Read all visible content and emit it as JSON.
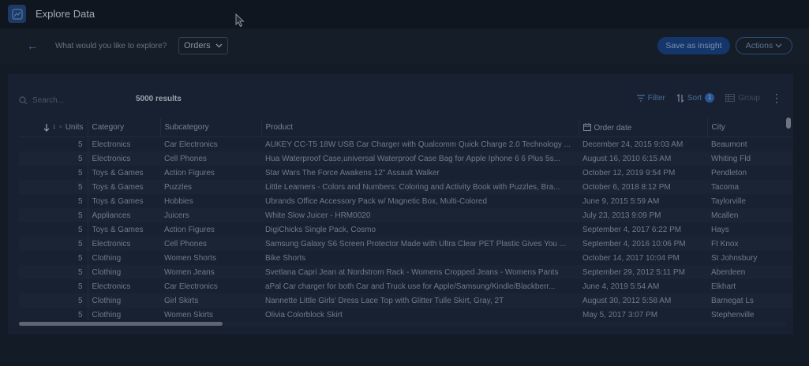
{
  "app": {
    "title": "Explore Data"
  },
  "toolbar": {
    "explore_label": "What would you like to explore?",
    "dataset_value": "Orders",
    "save_label": "Save as insight",
    "actions_label": "Actions"
  },
  "panel": {
    "search_placeholder": "Search...",
    "results_count": "5000 results",
    "filter_label": "Filter",
    "sort_label": "Sort",
    "sort_count": "1",
    "group_label": "Group"
  },
  "table": {
    "headers": {
      "sort_small": "1",
      "units": "Units",
      "category": "Category",
      "subcategory": "Subcategory",
      "product": "Product",
      "order_date": "Order date",
      "city": "City"
    },
    "rows": [
      {
        "units": "5",
        "category": "Electronics",
        "subcategory": "Car Electronics",
        "product": "AUKEY CC-T5 18W USB Car Charger with Qualcomm Quick Charge 2.0 Technology ...",
        "order_date": "December 24, 2015 9:03 AM",
        "city": "Beaumont"
      },
      {
        "units": "5",
        "category": "Electronics",
        "subcategory": "Cell Phones",
        "product": "Hua Waterproof Case,universal Waterproof Case Bag for Apple Iphone 6 6 Plus 5s...",
        "order_date": "August 16, 2010 6:15 AM",
        "city": "Whiting Fld"
      },
      {
        "units": "5",
        "category": "Toys & Games",
        "subcategory": "Action Figures",
        "product": "Star Wars The Force Awakens 12\" Assault Walker",
        "order_date": "October 12, 2019 9:54 PM",
        "city": "Pendleton"
      },
      {
        "units": "5",
        "category": "Toys & Games",
        "subcategory": "Puzzles",
        "product": "Little Learners - Colors and Numbers: Coloring and Activity Book with Puzzles, Bra...",
        "order_date": "October 6, 2018 8:12 PM",
        "city": "Tacoma"
      },
      {
        "units": "5",
        "category": "Toys & Games",
        "subcategory": "Hobbies",
        "product": "Ubrands Office Accessory Pack w/ Magnetic Box, Multi-Colored",
        "order_date": "June 9, 2015 5:59 AM",
        "city": "Taylorville"
      },
      {
        "units": "5",
        "category": "Appliances",
        "subcategory": "Juicers",
        "product": "White Slow Juicer - HRM0020",
        "order_date": "July 23, 2013 9:09 PM",
        "city": "Mcallen"
      },
      {
        "units": "5",
        "category": "Toys & Games",
        "subcategory": "Action Figures",
        "product": "DigiChicks Single Pack, Cosmo",
        "order_date": "September 4, 2017 6:22 PM",
        "city": "Hays"
      },
      {
        "units": "5",
        "category": "Electronics",
        "subcategory": "Cell Phones",
        "product": "Samsung Galaxy S6 Screen Protector Made with Ultra Clear PET Plastic Gives You ...",
        "order_date": "September 4, 2016 10:06 PM",
        "city": "Ft Knox"
      },
      {
        "units": "5",
        "category": "Clothing",
        "subcategory": "Women Shorts",
        "product": "Bike Shorts",
        "order_date": "October 14, 2017 10:04 PM",
        "city": "St Johnsbury"
      },
      {
        "units": "5",
        "category": "Clothing",
        "subcategory": "Women Jeans",
        "product": "Svetlana Capri Jean at Nordstrom Rack - Womens Cropped Jeans - Womens Pants",
        "order_date": "September 29, 2012 5:11 PM",
        "city": "Aberdeen"
      },
      {
        "units": "5",
        "category": "Electronics",
        "subcategory": "Car Electronics",
        "product": "aPal Car charger for both Car and Truck use for Apple/Samsung/Kindle/Blackberr...",
        "order_date": "June 4, 2019 5:54 AM",
        "city": "Elkhart"
      },
      {
        "units": "5",
        "category": "Clothing",
        "subcategory": "Girl Skirts",
        "product": "Nannette Little Girls' Dress Lace Top with Glitter Tulle Skirt, Gray, 2T",
        "order_date": "August 30, 2012 5:58 AM",
        "city": "Barnegat Ls"
      },
      {
        "units": "5",
        "category": "Clothing",
        "subcategory": "Women Skirts",
        "product": "Olivia Colorblock Skirt",
        "order_date": "May 5, 2017 3:07 PM",
        "city": "Stephenville"
      }
    ]
  },
  "icons": {
    "logo": "chart-logo-icon",
    "back": "arrow-left-icon",
    "dropdown": "chevron-down-icon",
    "search": "search-icon",
    "filter": "filter-icon",
    "sort": "sort-icon",
    "group": "table-group-icon",
    "more": "vertical-dots-icon",
    "calendar": "calendar-icon",
    "sort_direction": "arrow-down-icon"
  },
  "colors": {
    "accent": "#14366b",
    "link": "#3e74b5",
    "background": "#131b27"
  }
}
